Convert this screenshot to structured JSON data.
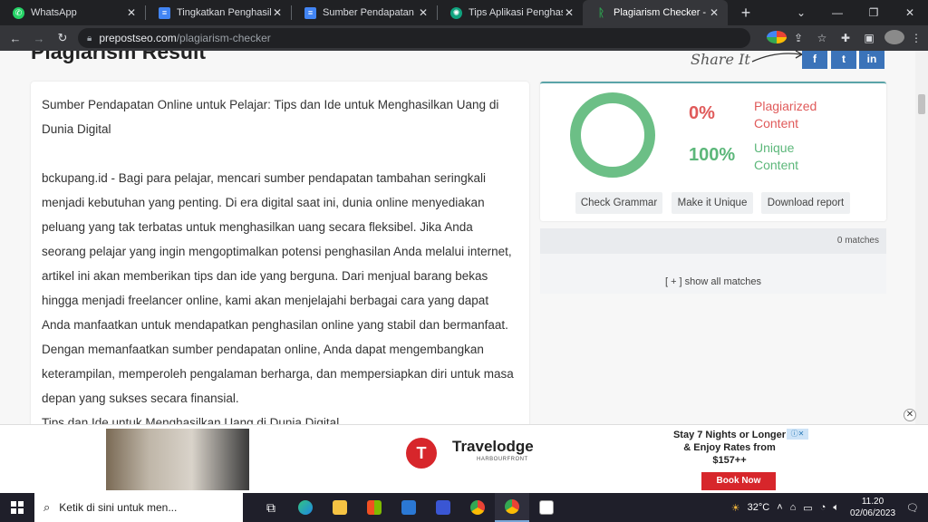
{
  "browser": {
    "tabs": [
      {
        "label": "WhatsApp",
        "icon": "whatsapp-icon",
        "color": "#25d366"
      },
      {
        "label": "Tingkatkan Penghasilan A",
        "icon": "docs-icon",
        "color": "#4285f4"
      },
      {
        "label": "Sumber Pendapatan Onli",
        "icon": "docs-icon",
        "color": "#4285f4"
      },
      {
        "label": "Tips Aplikasi Penghasil U",
        "icon": "chatgpt-icon",
        "color": "#10a37f"
      },
      {
        "label": "Plagiarism Checker - Free",
        "icon": "prepostseo-icon",
        "color": "#2e9c4f"
      }
    ],
    "new_tab": "+",
    "url_host": "prepostseo.com",
    "url_path": "/plagiarism-checker"
  },
  "page": {
    "heading": "Plagiarism Result",
    "share_label": "Share It",
    "share_buttons": [
      "f",
      "t",
      "in"
    ],
    "article_title": "Sumber Pendapatan Online untuk Pelajar: Tips dan Ide untuk Menghasilkan Uang di Dunia Digital",
    "article_body": "bckupang.id - Bagi para pelajar, mencari sumber pendapatan tambahan seringkali menjadi kebutuhan yang penting. Di era digital saat ini, dunia online menyediakan peluang yang tak terbatas untuk menghasilkan uang secara fleksibel. Jika Anda seorang pelajar yang ingin mengoptimalkan potensi penghasilan Anda melalui internet, artikel ini akan memberikan tips dan ide yang berguna. Dari menjual barang bekas hingga menjadi freelancer online, kami akan menjelajahi berbagai cara yang dapat Anda manfaatkan untuk mendapatkan penghasilan online yang stabil dan bermanfaat. Dengan memanfaatkan sumber pendapatan online, Anda dapat mengembangkan keterampilan, memperoleh pengalaman berharga, dan mempersiapkan diri untuk masa depan yang sukses secara finansial.",
    "article_subheading": "Tips dan Ide untuk Menghasilkan Uang di Dunia Digital"
  },
  "result": {
    "plagiarized_pct": "0%",
    "plagiarized_label": "Plagiarized Content",
    "unique_pct": "100%",
    "unique_label": "Unique Content",
    "unique_fraction": 1.0,
    "buttons": {
      "check_grammar": "Check Grammar",
      "make_unique": "Make it Unique",
      "download_report": "Download report"
    },
    "matches": "0 matches",
    "show_all": "[ + ] show all matches"
  },
  "ad": {
    "brand": "Travelodge",
    "brand_sub": "HARBOURFRONT",
    "offer": "Stay 7 Nights or Longer & Enjoy Rates from $157++",
    "cta": "Book Now",
    "close": "✕"
  },
  "taskbar": {
    "search_placeholder": "Ketik di sini untuk men...",
    "weather": "32°C",
    "time": "11.20",
    "date": "02/06/2023"
  },
  "colors": {
    "plagiarized": "#e05a5a",
    "unique": "#5cb77a",
    "share_button": "#3b73b9"
  }
}
